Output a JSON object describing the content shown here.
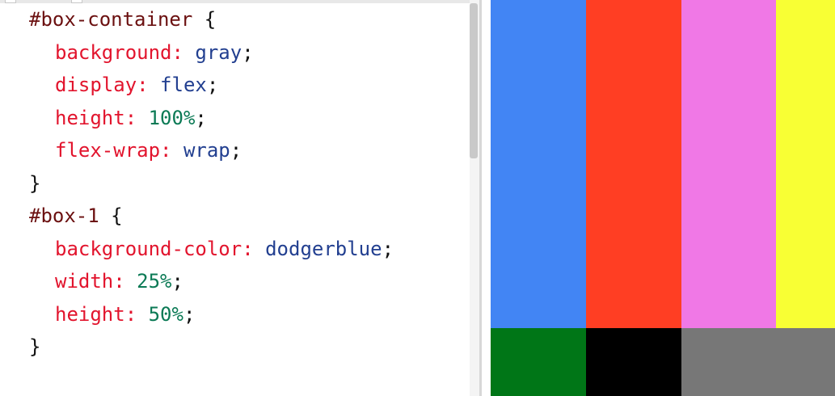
{
  "editor": {
    "lines": [
      {
        "tokens": [
          {
            "text": "#box-container",
            "type": "sel"
          },
          {
            "text": " {",
            "type": "punct"
          }
        ]
      },
      {
        "indent": true,
        "tokens": [
          {
            "text": "background:",
            "type": "prop"
          },
          {
            "text": " gray",
            "type": "kw"
          },
          {
            "text": ";",
            "type": "punct"
          }
        ]
      },
      {
        "indent": true,
        "tokens": [
          {
            "text": "display:",
            "type": "prop"
          },
          {
            "text": " flex",
            "type": "kw"
          },
          {
            "text": ";",
            "type": "punct"
          }
        ]
      },
      {
        "indent": true,
        "tokens": [
          {
            "text": "height:",
            "type": "prop"
          },
          {
            "text": " 100%",
            "type": "num"
          },
          {
            "text": ";",
            "type": "punct"
          }
        ]
      },
      {
        "indent": true,
        "tokens": [
          {
            "text": "flex-wrap:",
            "type": "prop"
          },
          {
            "text": " wrap",
            "type": "kw"
          },
          {
            "text": ";",
            "type": "punct"
          }
        ]
      },
      {
        "tokens": [
          {
            "text": "}",
            "type": "punct"
          }
        ]
      },
      {
        "tokens": [
          {
            "text": "#box-1",
            "type": "sel"
          },
          {
            "text": " {",
            "type": "punct"
          }
        ]
      },
      {
        "indent": true,
        "tokens": [
          {
            "text": "background-color:",
            "type": "prop"
          },
          {
            "text": " dodgerblue",
            "type": "kw"
          },
          {
            "text": ";",
            "type": "punct"
          }
        ]
      },
      {
        "indent": true,
        "tokens": [
          {
            "text": "width:",
            "type": "prop"
          },
          {
            "text": " 25%",
            "type": "num"
          },
          {
            "text": ";",
            "type": "punct"
          }
        ]
      },
      {
        "indent": true,
        "tokens": [
          {
            "text": "height:",
            "type": "prop"
          },
          {
            "text": " 50%",
            "type": "num"
          },
          {
            "text": ";",
            "type": "punct"
          }
        ]
      },
      {
        "tokens": [
          {
            "text": "}",
            "type": "punct"
          }
        ]
      }
    ]
  },
  "preview": {
    "container_color": "#777777",
    "boxes": [
      {
        "id": "box-1",
        "color": "#4285f4"
      },
      {
        "id": "box-2",
        "color": "#ff3e23"
      },
      {
        "id": "box-3",
        "color": "#f078e6"
      },
      {
        "id": "box-4",
        "color": "#f8ff34"
      },
      {
        "id": "box-5",
        "color": "#007617"
      },
      {
        "id": "box-6",
        "color": "#000000"
      }
    ]
  }
}
